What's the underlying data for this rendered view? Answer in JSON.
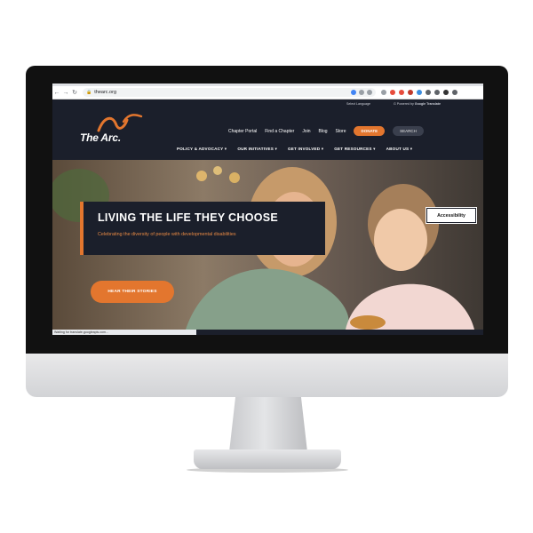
{
  "browser": {
    "url": "thearc.org",
    "nav": {
      "back": "←",
      "forward": "→",
      "reload": "↻"
    },
    "status_text": "Waiting for translate.googleapis.com..."
  },
  "lang_bar": {
    "select_label": "Select Language",
    "powered_by": "Powered by",
    "translate_brand": "Google Translate"
  },
  "site": {
    "logo_text": "The Arc.",
    "colors": {
      "accent": "#e3762e",
      "navy": "#1b1f2b"
    }
  },
  "topnav": {
    "items": [
      "Chapter Portal",
      "Find a Chapter",
      "Join",
      "Blog",
      "Store"
    ],
    "donate": "DONATE",
    "search": "SEARCH"
  },
  "mainnav": {
    "items": [
      {
        "label": "POLICY & ADVOCACY ▾"
      },
      {
        "label": "OUR INITIATIVES ▾"
      },
      {
        "label": "GET INVOLVED ▾"
      },
      {
        "label": "GET RESOURCES ▾"
      },
      {
        "label": "ABOUT US ▾"
      }
    ]
  },
  "hero": {
    "headline": "LIVING THE LIFE THEY CHOOSE",
    "subline": "Celebrating the diversity of people with developmental disabilities",
    "cta": "HEAR THEIR STORIES",
    "accessibility": "Accessibility"
  }
}
